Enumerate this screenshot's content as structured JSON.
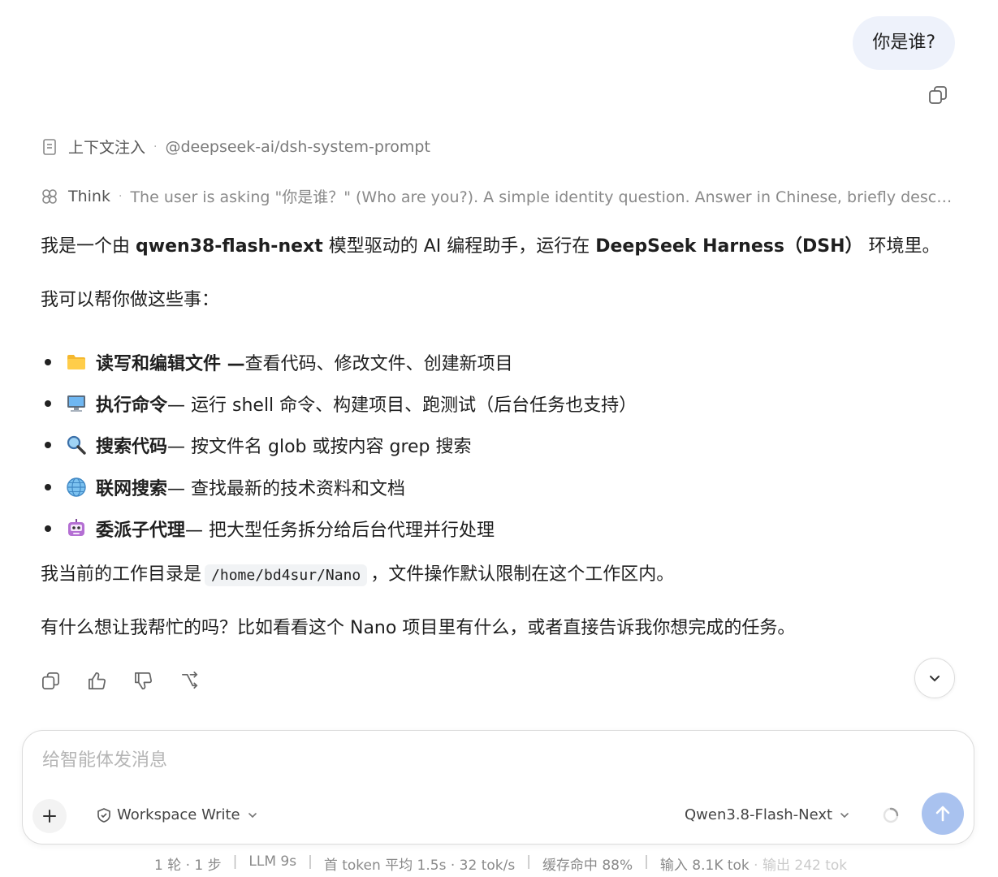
{
  "user_message": "你是谁?",
  "context": {
    "label": "上下文注入",
    "source": "@deepseek-ai/dsh-system-prompt"
  },
  "think": {
    "label": "Think",
    "text": "The user is asking \"你是谁？\" (Who are you?). A simple identity question. Answer in Chinese, briefly describi..."
  },
  "answer": {
    "p1": {
      "a": "我是一个由 ",
      "b1": "qwen38-flash-next",
      "c": " 模型驱动的 AI 编程助手，运行在 ",
      "b2": "DeepSeek Harness（DSH）",
      "d": " 环境里。"
    },
    "p2": "我可以帮你做这些事：",
    "items": [
      {
        "icon": "folder-icon",
        "title": "读写和编辑文件 —",
        "desc": " 查看代码、修改文件、创建新项目"
      },
      {
        "icon": "computer-icon",
        "title": "执行命令",
        "desc": " — 运行 shell 命令、构建项目、跑测试（后台任务也支持）"
      },
      {
        "icon": "magnifier-icon",
        "title": "搜索代码",
        "desc": " — 按文件名 glob 或按内容 grep 搜索"
      },
      {
        "icon": "globe-icon",
        "title": "联网搜索",
        "desc": " — 查找最新的技术资料和文档"
      },
      {
        "icon": "robot-icon",
        "title": "委派子代理",
        "desc": " — 把大型任务拆分给后台代理并行处理"
      }
    ],
    "p3": {
      "a": "我当前的工作目录是",
      "code": "/home/bd4sur/Nano",
      "b": "，文件操作默认限制在这个工作区内。"
    },
    "p4": "有什么想让我帮忙的吗？比如看看这个 Nano 项目里有什么，或者直接告诉我你想完成的任务。"
  },
  "composer": {
    "placeholder": "给智能体发消息",
    "permission": "Workspace Write",
    "model": "Qwen3.8-Flash-Next"
  },
  "stats": {
    "rounds": "1 轮 · 1 步",
    "llm": "LLM 9s",
    "token": "首 token 平均 1.5s · 32 tok/s",
    "cache": "缓存命中 88%",
    "io": "输入 8.1K tok · 输出 242 tok"
  },
  "colors": {
    "user_bubble": "#eef2fb",
    "send_button": "#a9c2ef",
    "muted": "#8a8a8a"
  }
}
